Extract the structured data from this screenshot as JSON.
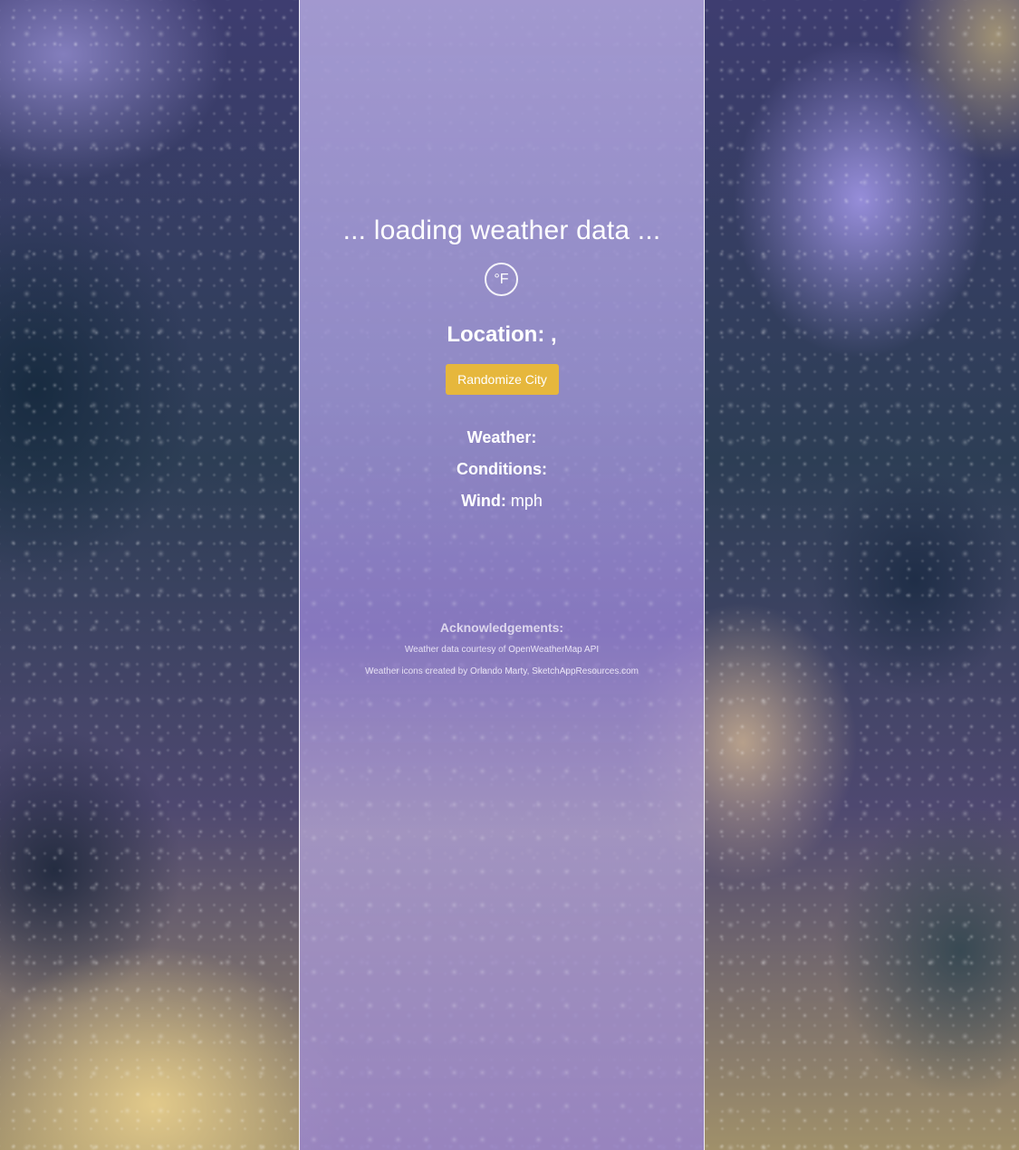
{
  "heading": "... loading weather data ...",
  "unit_toggle": {
    "label": "°F",
    "icon": "fahrenheit-icon"
  },
  "location": {
    "label": "Location:",
    "value": ","
  },
  "randomize_button": {
    "label": "Randomize City",
    "color": "#e6b73c"
  },
  "weather": {
    "label": "Weather:",
    "value": ""
  },
  "conditions": {
    "label": "Conditions:",
    "value": ""
  },
  "wind": {
    "label": "Wind:",
    "value": "mph"
  },
  "acknowledgements": {
    "title": "Acknowledgements:",
    "line1_prefix": "Weather data courtesy of ",
    "line1_link": "OpenWeatherMap API",
    "line2_prefix": "Weather icons created by ",
    "line2_link1": "Orlando Marty",
    "line2_sep": ", ",
    "line2_link2": "SketchAppResources.com"
  },
  "colors": {
    "panel": "#a89fd8",
    "accent": "#e6b73c",
    "text": "#ffffff"
  }
}
